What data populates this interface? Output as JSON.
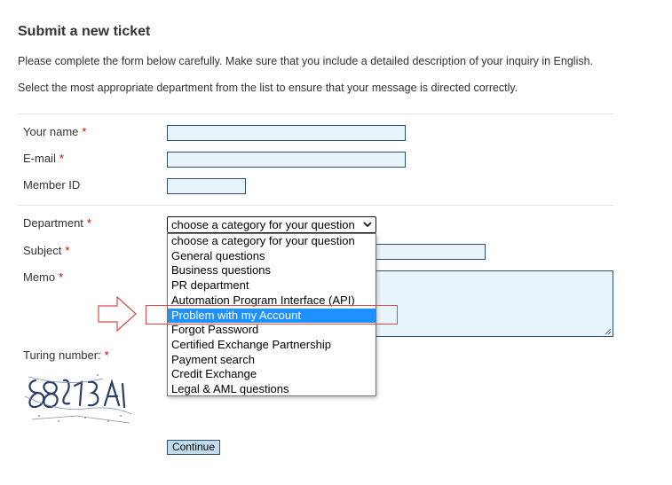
{
  "page": {
    "title": "Submit a new ticket",
    "intro_1": "Please complete the form below carefully. Make sure that you include a detailed description of your inquiry in English.",
    "intro_2": "Select the most appropriate department from the list to ensure that your message is directed correctly."
  },
  "form": {
    "name_label": "Your name",
    "email_label": "E-mail",
    "member_id_label": "Member ID",
    "department_label": "Department",
    "subject_label": "Subject",
    "memo_label": "Memo",
    "turing_label": "Turing number:",
    "required_mark": "*",
    "department_selected": "choose a category for your question",
    "department_options": [
      "choose a category for your question",
      "General questions",
      "Business questions",
      "PR department",
      "Automation Program Interface (API)",
      "Problem with my Account",
      "Forgot Password",
      "Certified Exchange Partnership",
      "Payment search",
      "Credit Exchange",
      "Legal & AML questions"
    ],
    "highlighted_option": "Problem with my Account",
    "continue_label": "Continue"
  },
  "colors": {
    "field_bg": "#e8f4fb",
    "field_border": "#2f4f6f",
    "required": "#cc0000",
    "selected_option_bg": "#1e90ff",
    "annotation_red": "#d94a4a"
  }
}
